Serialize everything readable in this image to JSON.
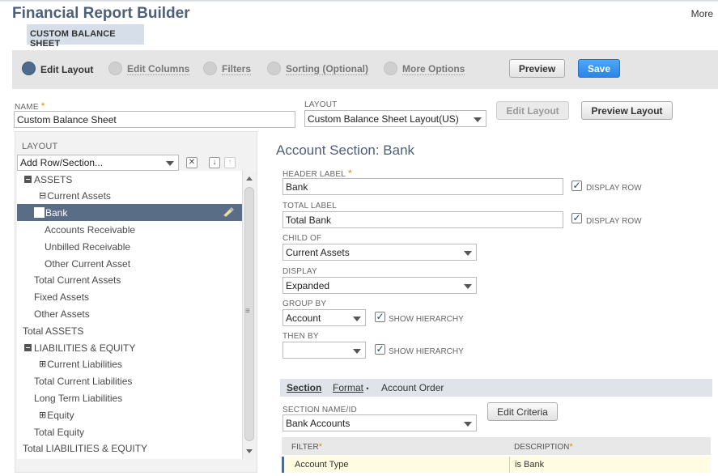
{
  "header": {
    "title": "Financial Report Builder",
    "subtitle": "CUSTOM BALANCE SHEET",
    "more": "More"
  },
  "steps": [
    {
      "label": "Edit Layout",
      "active": true
    },
    {
      "label": "Edit Columns",
      "active": false
    },
    {
      "label": "Filters",
      "active": false
    },
    {
      "label": "Sorting (Optional)",
      "active": false
    },
    {
      "label": "More Options",
      "active": false
    }
  ],
  "actions": {
    "preview": "Preview",
    "save": "Save"
  },
  "form": {
    "name_label": "NAME",
    "name_value": "Custom Balance Sheet",
    "layout_label": "LAYOUT",
    "layout_value": "Custom Balance Sheet Layout(US)",
    "edit_layout": "Edit Layout",
    "preview_layout": "Preview Layout"
  },
  "layout_panel": {
    "heading": "LAYOUT",
    "add_row_select": "Add Row/Section...",
    "items": [
      {
        "label": "ASSETS",
        "expander": "minus"
      },
      {
        "label": "Current Assets",
        "expander": "minus-small"
      },
      {
        "label": "Bank",
        "selected": true
      },
      {
        "label": "Accounts Receivable"
      },
      {
        "label": "Unbilled Receivable"
      },
      {
        "label": "Other Current Asset"
      },
      {
        "label": "Total Current Assets"
      },
      {
        "label": "Fixed Assets"
      },
      {
        "label": "Other Assets"
      },
      {
        "label": "Total ASSETS"
      },
      {
        "label": "LIABILITIES & EQUITY",
        "expander": "minus"
      },
      {
        "label": "Current Liabilities",
        "expander": "plus"
      },
      {
        "label": "Total Current Liabilities"
      },
      {
        "label": "Long Term Liabilities"
      },
      {
        "label": "Equity",
        "expander": "plus"
      },
      {
        "label": "Total Equity"
      },
      {
        "label": "Total LIABILITIES & EQUITY"
      }
    ]
  },
  "detail": {
    "title": "Account Section: Bank",
    "header_label": "HEADER LABEL",
    "header_value": "Bank",
    "total_label": "TOTAL LABEL",
    "total_value": "Total Bank",
    "display_row": "DISPLAY ROW",
    "child_of_label": "CHILD OF",
    "child_of_value": "Current Assets",
    "display_label": "DISPLAY",
    "display_value": "Expanded",
    "group_by_label": "GROUP BY",
    "group_by_value": "Account",
    "show_hierarchy": "SHOW HIERARCHY",
    "then_by_label": "THEN BY",
    "then_by_value": ""
  },
  "subtabs": {
    "section": "Section",
    "format": "Format",
    "format_marker": "•",
    "account_order": "Account Order"
  },
  "section_tab": {
    "name_label": "SECTION NAME/ID",
    "name_value": "Bank Accounts",
    "edit_criteria": "Edit Criteria",
    "col_filter": "FILTER",
    "col_description": "DESCRIPTION",
    "row_filter": "Account Type",
    "row_description": "is Bank"
  },
  "colors": {
    "title": "#4d5f79",
    "selected_row": "#5a6d86",
    "save_button": "#2a85e6",
    "required": "#d98a1f"
  }
}
